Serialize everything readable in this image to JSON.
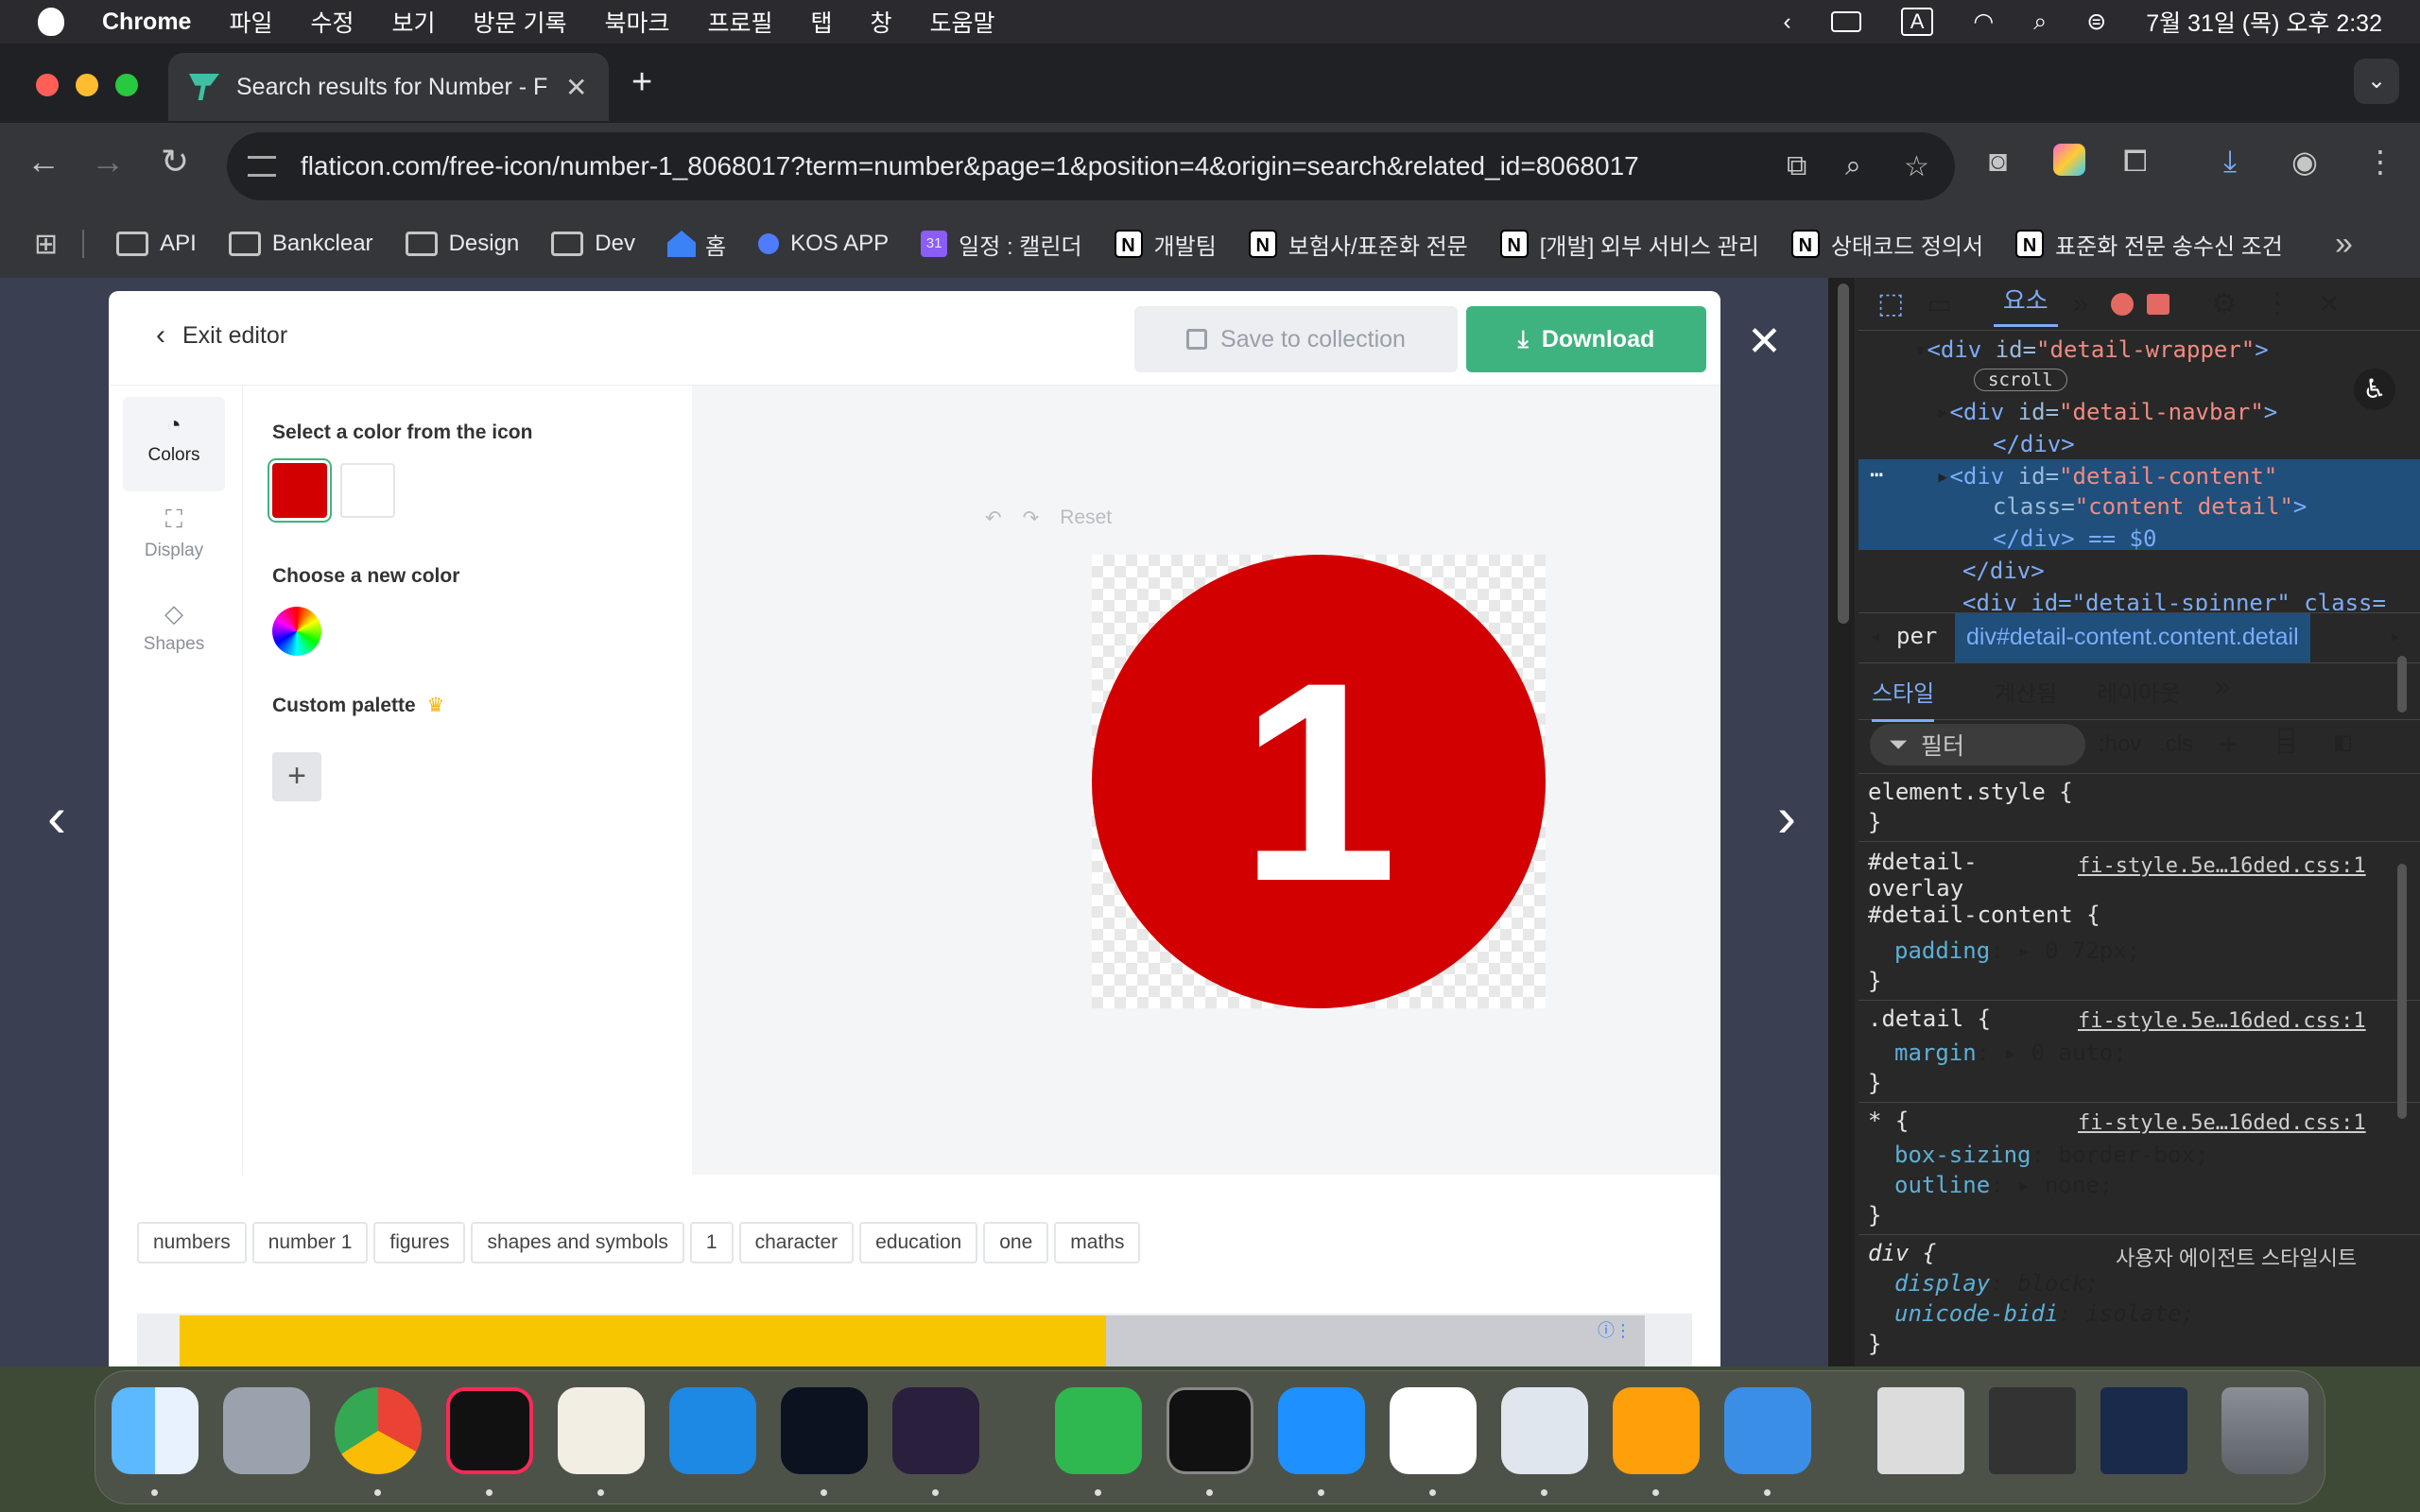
{
  "menubar": {
    "app": "Chrome",
    "items": [
      "파일",
      "수정",
      "보기",
      "방문 기록",
      "북마크",
      "프로필",
      "탭",
      "창",
      "도움말"
    ],
    "datetime": "7월 31일 (목) 오후 2:32",
    "input_indicator": "A"
  },
  "browser": {
    "tab_title": "Search results for Number - F",
    "url": "flaticon.com/free-icon/number-1_8068017?term=number&page=1&position=4&origin=search&related_id=8068017",
    "bookmarks": [
      {
        "label": "API",
        "type": "folder"
      },
      {
        "label": "Bankclear",
        "type": "folder"
      },
      {
        "label": "Design",
        "type": "folder"
      },
      {
        "label": "Dev",
        "type": "folder"
      },
      {
        "label": "홈",
        "type": "home"
      },
      {
        "label": "KOS APP",
        "type": "app"
      },
      {
        "label": "일정 : 캘린더",
        "type": "calendar"
      },
      {
        "label": "개발팀",
        "type": "notion"
      },
      {
        "label": "보험사/표준화 전문",
        "type": "notion"
      },
      {
        "label": "[개발] 외부 서비스 관리",
        "type": "notion"
      },
      {
        "label": "상태코드 정의서",
        "type": "notion"
      },
      {
        "label": "표준화 전문 송수신 조건",
        "type": "notion"
      }
    ],
    "calendar_badge": "31"
  },
  "editor": {
    "exit_label": "Exit editor",
    "save_label": "Save to collection",
    "download_label": "Download",
    "sidenav": [
      {
        "label": "Colors",
        "icon": "palette-icon",
        "active": true
      },
      {
        "label": "Display",
        "icon": "expand-icon",
        "active": false
      },
      {
        "label": "Shapes",
        "icon": "shapes-icon",
        "active": false
      }
    ],
    "select_color_label": "Select a color from the icon",
    "icon_colors": [
      "#d20000",
      "#ffffff"
    ],
    "new_color_label": "Choose a new color",
    "custom_palette_label": "Custom palette",
    "reset_label": "Reset",
    "icon_glyph": "1",
    "icon_fill": "#d20000",
    "tags": [
      "numbers",
      "number 1",
      "figures",
      "shapes and symbols",
      "1",
      "character",
      "education",
      "one",
      "maths"
    ]
  },
  "devtools": {
    "tabs": {
      "elements": "요소"
    },
    "dom": {
      "line1_tag": "<div",
      "line1_attr": " id=",
      "line1_val": "\"detail-wrapper\"",
      "line1_end": ">",
      "badge": "scroll",
      "line2_tag": "<div",
      "line2_attr": " id=",
      "line2_val": "\"detail-navbar\"",
      "line2_end": ">",
      "close_div": "</div>",
      "line3_tag": "<div",
      "line3_attr": " id=",
      "line3_val": "\"detail-content\"",
      "line4_attr": "class=",
      "line4_val": "\"content detail\"",
      "line4_end": ">",
      "line5": "</div> == $0",
      "line6": "</div>",
      "line7": "<div id=\"detail-spinner\" class="
    },
    "breadcrumb_prev": "per",
    "breadcrumb": "div#detail-content.content.detail",
    "subtabs": [
      "스타일",
      "계산됨",
      "레이아웃"
    ],
    "filter_placeholder": "필터",
    "hov": ":hov",
    "cls": ".cls",
    "rules": [
      {
        "selector": "element.style {",
        "close": "}"
      },
      {
        "selector": "#detail-\noverlay\n#detail-content {",
        "source": "fi-style.5e…16ded.css:1",
        "prop": "padding",
        "value": "0 72px;"
      },
      {
        "selector": ".detail {",
        "source": "fi-style.5e…16ded.css:1",
        "prop": "margin",
        "value": "0 auto;"
      },
      {
        "selector": "* {",
        "source": "fi-style.5e…16ded.css:1",
        "prop": "box-sizing",
        "value": "border-box;",
        "prop2": "outline",
        "value2": "none;"
      },
      {
        "selector": "div {",
        "source": "사용자 에이전트 스타일시트",
        "prop": "display",
        "value": "block;",
        "prop2": "unicode-bidi",
        "value2": "isolate;"
      }
    ]
  }
}
